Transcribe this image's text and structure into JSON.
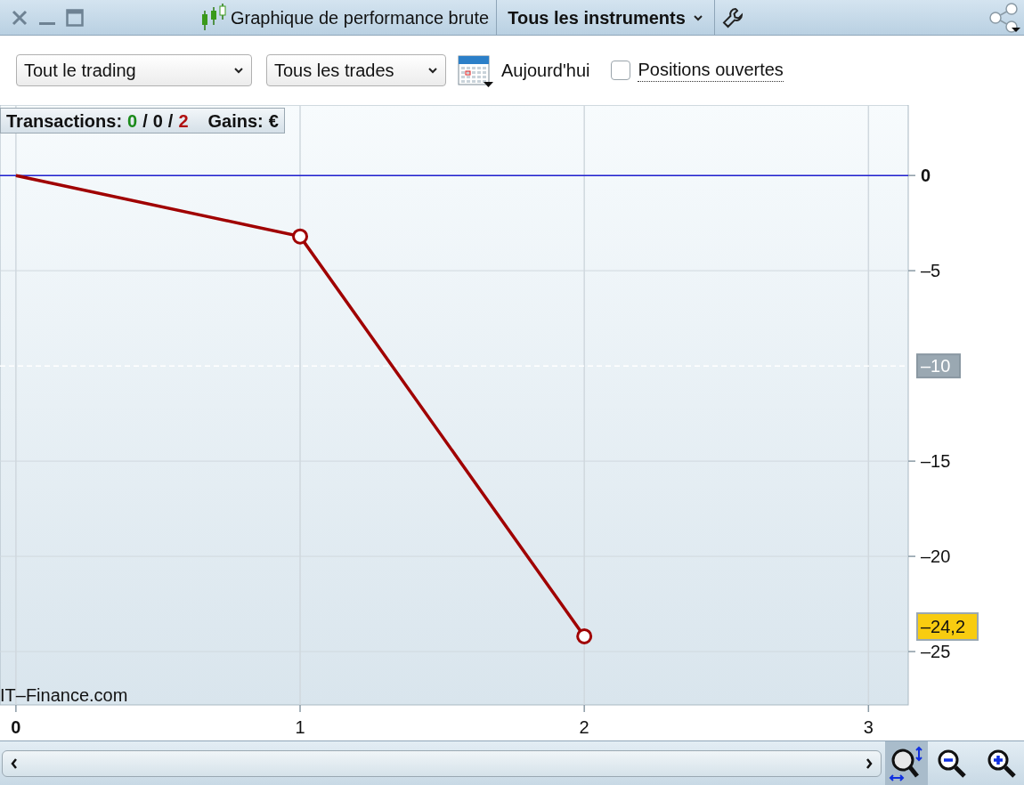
{
  "window": {
    "title": "Graphique de performance brute",
    "instrument_menu": "Tous les instruments"
  },
  "filters": {
    "scope": "Tout le trading",
    "trades": "Tous les trades",
    "date": "Aujourd'hui",
    "open_positions": {
      "label": "Positions ouvertes",
      "checked": false
    }
  },
  "stats": {
    "label": "Transactions:",
    "wins": "0",
    "even": "0",
    "losses": "2",
    "separator": "/",
    "gains_label": "Gains:",
    "gains_value": "€"
  },
  "chart_data": {
    "type": "line",
    "x": [
      0,
      1,
      2
    ],
    "series": [
      {
        "color": "#a00000",
        "values": [
          0,
          -3.2,
          -24.2
        ]
      }
    ],
    "grid": true,
    "xlim": [
      -0.056,
      3.14
    ],
    "ylim": [
      -27.8,
      3.7
    ],
    "xticks": [
      0,
      1,
      2,
      3
    ],
    "yticks": [
      {
        "value": 0,
        "label": "0"
      },
      {
        "value": -5,
        "label": "–5"
      },
      {
        "value": -15,
        "label": "–15"
      },
      {
        "value": -20,
        "label": "–20"
      },
      {
        "value": -25,
        "label": "–25"
      }
    ],
    "ref_lines": [
      {
        "axis": "y",
        "value": 0,
        "color": "#2020d0"
      },
      {
        "axis": "y",
        "value": -10,
        "color": "#ffffff",
        "label": "–10"
      }
    ],
    "annotations": [
      "–24,2"
    ]
  },
  "credit": "IT–Finance.com"
}
